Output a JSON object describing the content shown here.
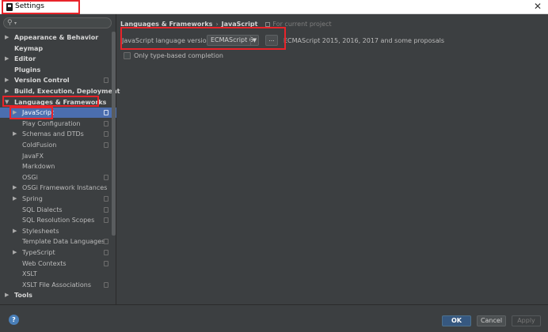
{
  "window": {
    "title": "Settings",
    "close_glyph": "✕"
  },
  "search": {
    "icon": "search-icon",
    "placeholder": ""
  },
  "sidebar": {
    "items": [
      {
        "label": "Appearance & Behavior",
        "arrow": "▶",
        "bold": true,
        "level": 0,
        "copy": false
      },
      {
        "label": "Keymap",
        "arrow": "",
        "bold": true,
        "level": 0,
        "copy": false
      },
      {
        "label": "Editor",
        "arrow": "▶",
        "bold": true,
        "level": 0,
        "copy": false
      },
      {
        "label": "Plugins",
        "arrow": "",
        "bold": true,
        "level": 0,
        "copy": false
      },
      {
        "label": "Version Control",
        "arrow": "▶",
        "bold": true,
        "level": 0,
        "copy": true
      },
      {
        "label": "Build, Execution, Deployment",
        "arrow": "▶",
        "bold": true,
        "level": 0,
        "copy": false
      },
      {
        "label": "Languages & Frameworks",
        "arrow": "▼",
        "bold": true,
        "level": 0,
        "copy": false
      },
      {
        "label": "JavaScript",
        "arrow": "▶",
        "bold": false,
        "level": 1,
        "copy": true,
        "selected": true
      },
      {
        "label": "Play Configuration",
        "arrow": "",
        "bold": false,
        "level": 1,
        "copy": true
      },
      {
        "label": "Schemas and DTDs",
        "arrow": "▶",
        "bold": false,
        "level": 1,
        "copy": true
      },
      {
        "label": "ColdFusion",
        "arrow": "",
        "bold": false,
        "level": 1,
        "copy": true
      },
      {
        "label": "JavaFX",
        "arrow": "",
        "bold": false,
        "level": 1,
        "copy": false
      },
      {
        "label": "Markdown",
        "arrow": "",
        "bold": false,
        "level": 1,
        "copy": false
      },
      {
        "label": "OSGi",
        "arrow": "",
        "bold": false,
        "level": 1,
        "copy": true
      },
      {
        "label": "OSGi Framework Instances",
        "arrow": "▶",
        "bold": false,
        "level": 1,
        "copy": false
      },
      {
        "label": "Spring",
        "arrow": "▶",
        "bold": false,
        "level": 1,
        "copy": true
      },
      {
        "label": "SQL Dialects",
        "arrow": "",
        "bold": false,
        "level": 1,
        "copy": true
      },
      {
        "label": "SQL Resolution Scopes",
        "arrow": "",
        "bold": false,
        "level": 1,
        "copy": true
      },
      {
        "label": "Stylesheets",
        "arrow": "▶",
        "bold": false,
        "level": 1,
        "copy": false
      },
      {
        "label": "Template Data Languages",
        "arrow": "",
        "bold": false,
        "level": 1,
        "copy": true
      },
      {
        "label": "TypeScript",
        "arrow": "▶",
        "bold": false,
        "level": 1,
        "copy": true
      },
      {
        "label": "Web Contexts",
        "arrow": "",
        "bold": false,
        "level": 1,
        "copy": true
      },
      {
        "label": "XSLT",
        "arrow": "",
        "bold": false,
        "level": 1,
        "copy": false
      },
      {
        "label": "XSLT File Associations",
        "arrow": "",
        "bold": false,
        "level": 1,
        "copy": true
      },
      {
        "label": "Tools",
        "arrow": "▶",
        "bold": true,
        "level": 0,
        "copy": false
      }
    ]
  },
  "main": {
    "breadcrumb": [
      "Languages & Frameworks",
      "JavaScript"
    ],
    "breadcrumb_separator": "›",
    "scope_note": "For current project",
    "js_version": {
      "label": "JavaScript language version",
      "selected": "ECMAScript 6",
      "caret": "▼",
      "more_label": "...",
      "description": "ECMAScript 2015, 2016, 2017 and some proposals"
    },
    "type_based": {
      "label": "Only type-based completion",
      "checked": false
    }
  },
  "footer": {
    "help_label": "?",
    "ok_label": "OK",
    "cancel_label": "Cancel",
    "apply_label": "Apply"
  },
  "colors": {
    "background": "#3c3f41",
    "selection": "#4b6eaf",
    "highlight": "#e8242a",
    "ok_button": "#365880"
  }
}
